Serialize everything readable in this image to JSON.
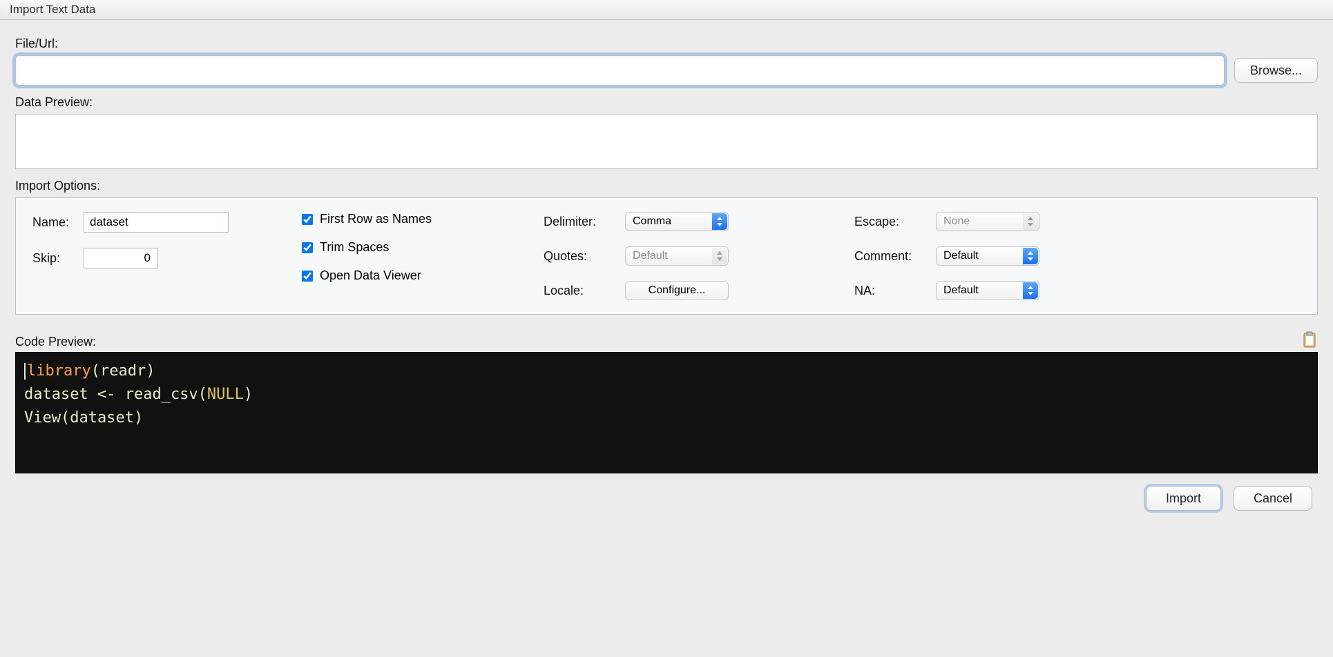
{
  "title": "Import Text Data",
  "file": {
    "label": "File/Url:",
    "value": "",
    "browse": "Browse..."
  },
  "preview": {
    "label": "Data Preview:"
  },
  "options": {
    "label": "Import Options:",
    "name_label": "Name:",
    "name_value": "dataset",
    "skip_label": "Skip:",
    "skip_value": "0",
    "cb_first_row": "First Row as Names",
    "cb_trim": "Trim Spaces",
    "cb_open_viewer": "Open Data Viewer",
    "delimiter_label": "Delimiter:",
    "delimiter_value": "Comma",
    "quotes_label": "Quotes:",
    "quotes_value": "Default",
    "locale_label": "Locale:",
    "locale_button": "Configure...",
    "escape_label": "Escape:",
    "escape_value": "None",
    "comment_label": "Comment:",
    "comment_value": "Default",
    "na_label": "NA:",
    "na_value": "Default"
  },
  "code": {
    "label": "Code Preview:",
    "line1_a": "library",
    "line1_b": "(readr)",
    "line2_a": "dataset ",
    "line2_op": "<-",
    "line2_b": " read_csv(",
    "line2_null": "NULL",
    "line2_c": ")",
    "line3": "View(dataset)"
  },
  "footer": {
    "import": "Import",
    "cancel": "Cancel"
  }
}
